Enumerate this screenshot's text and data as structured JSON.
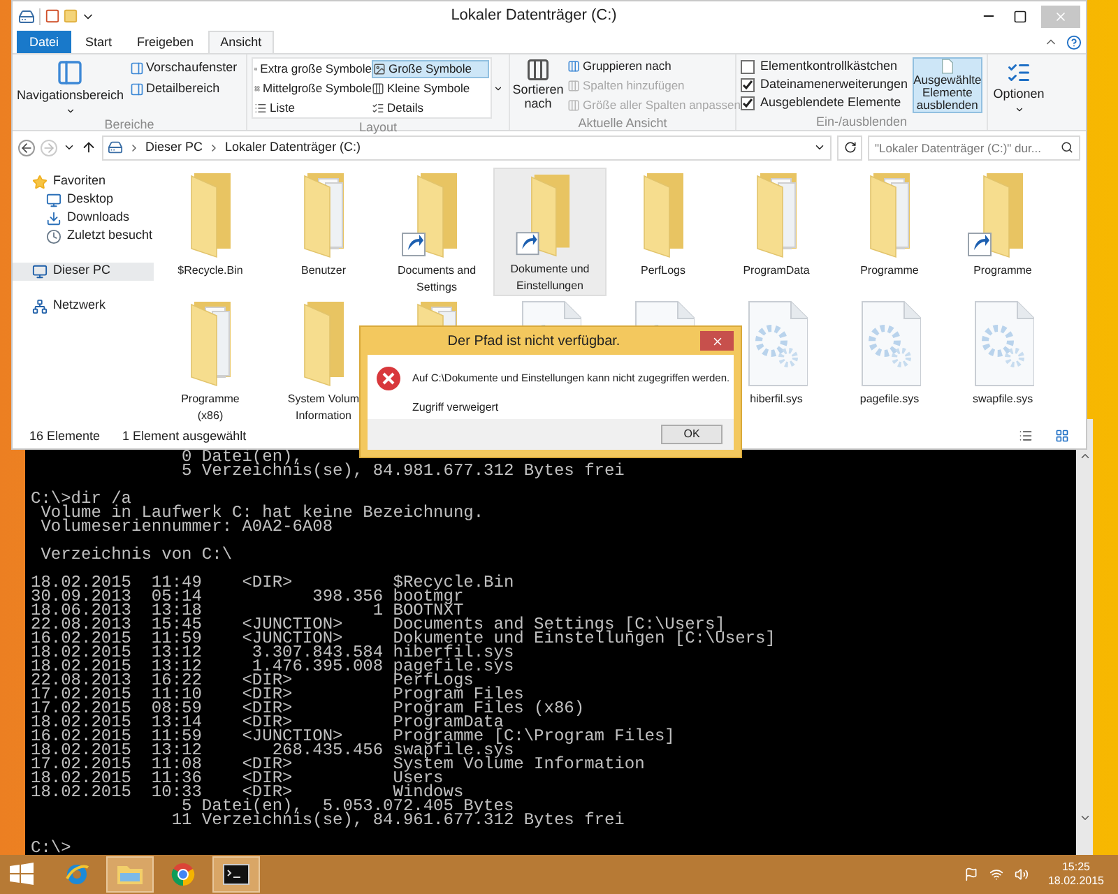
{
  "explorer": {
    "title": "Lokaler Datenträger (C:)",
    "tabs": [
      {
        "label": "Datei",
        "kind": "menu",
        "selected": false
      },
      {
        "label": "Start",
        "kind": "tab",
        "selected": false
      },
      {
        "label": "Freigeben",
        "kind": "tab",
        "selected": false
      },
      {
        "label": "Ansicht",
        "kind": "tab",
        "selected": true
      }
    ],
    "ribbon": {
      "panes": {
        "label": "Bereiche",
        "navigation": "Navigationsbereich",
        "items": [
          "Vorschaufenster",
          "Detailbereich"
        ]
      },
      "layout": {
        "label": "Layout",
        "options": [
          {
            "label": "Extra große Symbole",
            "selected": false
          },
          {
            "label": "Große Symbole",
            "selected": true
          },
          {
            "label": "Mittelgroße Symbole",
            "selected": false
          },
          {
            "label": "Kleine Symbole",
            "selected": false
          },
          {
            "label": "Liste",
            "selected": false
          },
          {
            "label": "Details",
            "selected": false
          }
        ]
      },
      "current_view": {
        "label": "Aktuelle Ansicht",
        "sort": "Sortieren nach",
        "commands": [
          {
            "label": "Gruppieren nach",
            "disabled": false
          },
          {
            "label": "Spalten hinzufügen",
            "disabled": true
          },
          {
            "label": "Größe aller Spalten anpassen",
            "disabled": true
          }
        ]
      },
      "show_hide": {
        "label": "Ein-/ausblenden",
        "checkboxes": [
          {
            "label": "Elementkontrollkästchen",
            "checked": false
          },
          {
            "label": "Dateinamenerweiterungen",
            "checked": true
          },
          {
            "label": "Ausgeblendete Elemente",
            "checked": true
          }
        ],
        "hide_selected": {
          "label": "Ausgewählte Elemente ausblenden",
          "selected": true
        }
      },
      "options": {
        "label": "Optionen"
      }
    },
    "address": {
      "path": [
        "Dieser PC",
        "Lokaler Datenträger (C:)"
      ],
      "search_placeholder": "\"Lokaler Datenträger (C:)\" dur..."
    },
    "navigation": [
      {
        "label": "Favoriten",
        "kind": "star",
        "selected": false,
        "children": [
          {
            "label": "Desktop",
            "kind": "desktop",
            "selected": false
          },
          {
            "label": "Downloads",
            "kind": "downloads",
            "selected": false
          },
          {
            "label": "Zuletzt besucht",
            "kind": "recent",
            "selected": false
          }
        ]
      },
      {
        "label": "Dieser PC",
        "kind": "pc",
        "selected": true
      },
      {
        "label": "Netzwerk",
        "kind": "network",
        "selected": false
      }
    ],
    "items": [
      {
        "label": "$Recycle.Bin",
        "kind": "folder",
        "selected": false
      },
      {
        "label": "Benutzer",
        "kind": "folder-papers",
        "selected": false
      },
      {
        "label": "Documents and Settings",
        "kind": "shortcut",
        "selected": false
      },
      {
        "label": "Dokumente und Einstellungen",
        "kind": "shortcut",
        "selected": true
      },
      {
        "label": "PerfLogs",
        "kind": "folder",
        "selected": false
      },
      {
        "label": "ProgramData",
        "kind": "folder-papers",
        "selected": false
      },
      {
        "label": "Programme",
        "kind": "folder-papers",
        "selected": false
      },
      {
        "label": "Programme",
        "kind": "shortcut",
        "selected": false
      },
      {
        "label": "Programme (x86)",
        "kind": "folder-papers",
        "selected": false
      },
      {
        "label": "System Volum Information",
        "kind": "folder",
        "selected": false
      },
      {
        "kind": "folder-papers",
        "selected": false
      },
      {
        "kind": "sysfile",
        "selected": false
      },
      {
        "kind": "sysfile",
        "selected": false
      },
      {
        "label": "hiberfil.sys",
        "kind": "sysfile",
        "selected": false
      },
      {
        "label": "pagefile.sys",
        "kind": "sysfile",
        "selected": false
      },
      {
        "label": "swapfile.sys",
        "kind": "sysfile",
        "selected": false
      }
    ],
    "status_bar": {
      "count": "16 Elemente",
      "selection": "1 Element ausgewählt"
    }
  },
  "dialog": {
    "title": "Der Pfad ist nicht verfügbar.",
    "message": "Auf C:\\Dokumente und Einstellungen kann nicht zugegriffen werden.",
    "detail": "Zugriff verweigert",
    "button": "OK"
  },
  "console": {
    "blocks": [
      [
        "               0 Datei(en),",
        "               5 Verzeichnis(se), 84.981.677.312 Bytes frei"
      ],
      [
        "C:\\>dir /a",
        " Volume in Laufwerk C: hat keine Bezeichnung.",
        " Volumeseriennummer: A0A2-6A08"
      ],
      [
        " Verzeichnis von C:\\"
      ],
      [
        "18.02.2015  11:49    <DIR>          $Recycle.Bin",
        "30.09.2013  05:14           398.356 bootmgr",
        "18.06.2013  13:18                 1 BOOTNXT",
        "22.08.2013  15:45    <JUNCTION>     Documents and Settings [C:\\Users]",
        "16.02.2015  11:59    <JUNCTION>     Dokumente und Einstellungen [C:\\Users]",
        "18.02.2015  13:12     3.307.843.584 hiberfil.sys",
        "18.02.2015  13:12     1.476.395.008 pagefile.sys",
        "22.08.2013  16:22    <DIR>          PerfLogs",
        "17.02.2015  11:10    <DIR>          Program Files",
        "17.02.2015  08:59    <DIR>          Program Files (x86)",
        "18.02.2015  13:14    <DIR>          ProgramData",
        "16.02.2015  11:59    <JUNCTION>     Programme [C:\\Program Files]",
        "18.02.2015  13:12       268.435.456 swapfile.sys",
        "17.02.2015  11:08    <DIR>          System Volume Information",
        "18.02.2015  11:36    <DIR>          Users",
        "18.02.2015  10:33    <DIR>          Windows",
        "               5 Datei(en),  5.053.072.405 Bytes",
        "              11 Verzeichnis(se), 84.961.677.312 Bytes frei"
      ],
      [
        "C:\\>"
      ]
    ]
  },
  "taskbar": {
    "apps": [
      {
        "kind": "ie",
        "active": false
      },
      {
        "kind": "explorer",
        "active": true
      },
      {
        "kind": "chrome",
        "active": false
      },
      {
        "kind": "cmd",
        "active": true
      }
    ],
    "time": "15:25",
    "date": "18.02.2015"
  }
}
